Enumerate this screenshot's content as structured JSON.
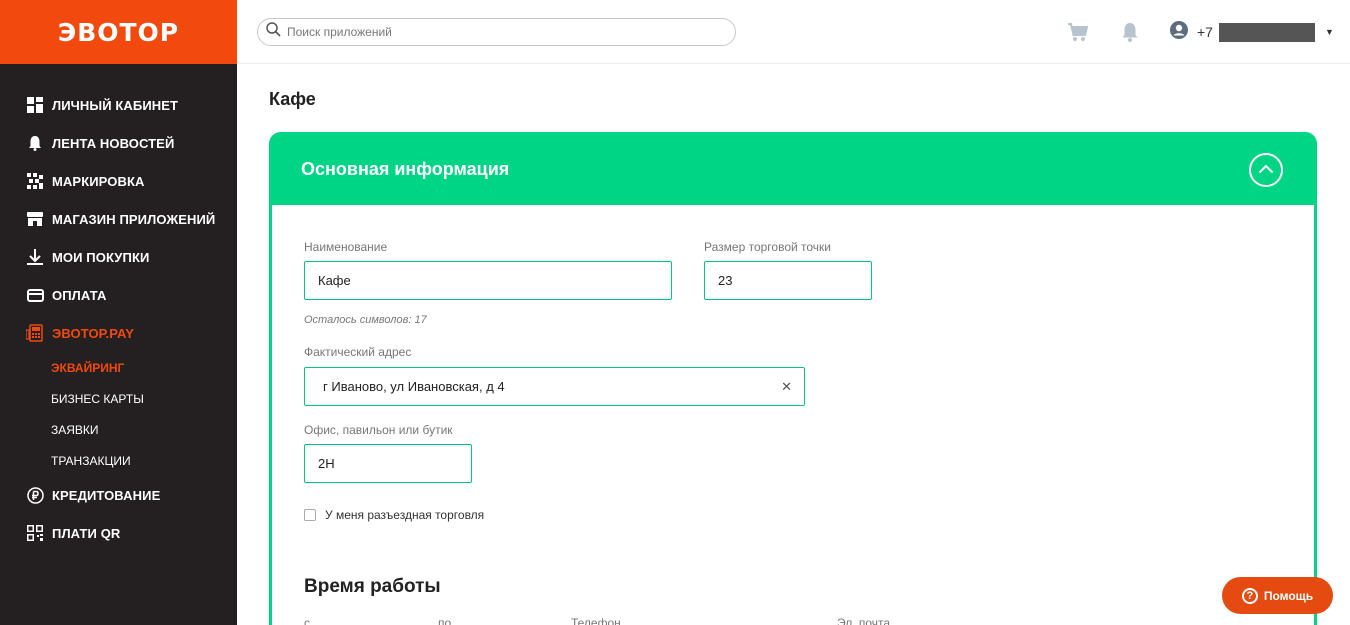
{
  "brand": {
    "logo": "ЭВОТОР",
    "color": "#f24a0e",
    "accent": "#00d485"
  },
  "sidebar": {
    "items": [
      {
        "label": "Личный кабинет",
        "icon": "dashboard-icon"
      },
      {
        "label": "Лента новостей",
        "icon": "bell-icon"
      },
      {
        "label": "Маркировка",
        "icon": "qr-pattern-icon"
      },
      {
        "label": "Магазин приложений",
        "icon": "store-icon"
      },
      {
        "label": "Мои покупки",
        "icon": "download-icon"
      },
      {
        "label": "Оплата",
        "icon": "card-icon"
      },
      {
        "label": "Эвотор.PAY",
        "icon": "pos-terminal-icon",
        "active": true
      },
      {
        "label": "Кредитование",
        "icon": "ruble-icon"
      },
      {
        "label": "Плати QR",
        "icon": "qr-code-icon"
      }
    ],
    "submenu": [
      {
        "label": "Эквайринг",
        "active": true
      },
      {
        "label": "Бизнес карты"
      },
      {
        "label": "Заявки"
      },
      {
        "label": "Транзакции"
      }
    ]
  },
  "header": {
    "search_placeholder": "Поиск приложений",
    "phone_prefix": "+7"
  },
  "main": {
    "page_title": "Кафе",
    "card_title": "Основная информация",
    "fields": {
      "name_label": "Наименование",
      "name_value": "Кафе",
      "name_hint": "Осталось символов: 17",
      "size_label": "Размер торговой точки",
      "size_value": "23",
      "address_label": "Фактический адрес",
      "address_value": "г Иваново, ул Ивановская, д 4",
      "office_label": "Офис, павильон или бутик",
      "office_value": "2Н",
      "mobile_trade_label": "У меня разъездная торговля",
      "mobile_trade_checked": false
    },
    "work_time": {
      "title": "Время работы",
      "columns": [
        "с",
        "по",
        "Телефон",
        "Эл. почта"
      ]
    }
  },
  "help": {
    "label": "Помощь"
  }
}
